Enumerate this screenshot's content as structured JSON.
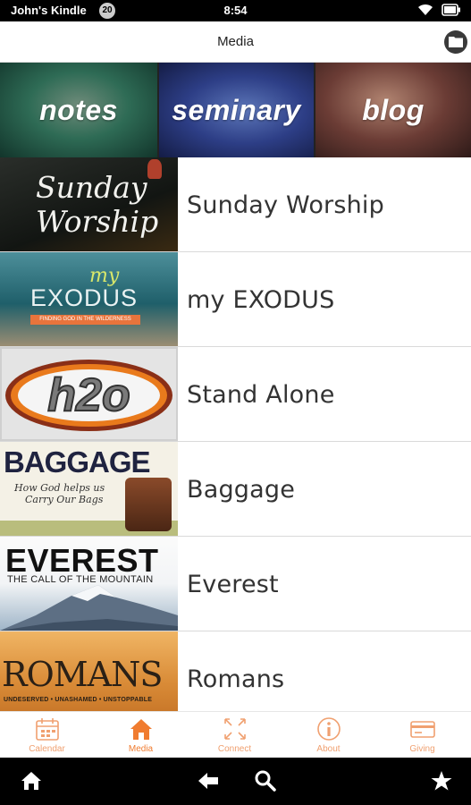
{
  "status_bar": {
    "owner": "John's Kindle",
    "notification_count": "20",
    "time": "8:54"
  },
  "header": {
    "title": "Media",
    "folder_icon": "folder-icon"
  },
  "categories": [
    {
      "label": "notes"
    },
    {
      "label": "seminary"
    },
    {
      "label": "blog"
    }
  ],
  "series": [
    {
      "title": "Sunday Worship",
      "thumb_line1": "Sunday",
      "thumb_line2": "Worship"
    },
    {
      "title": "my EXODUS",
      "thumb_my": "my",
      "thumb_main": "EXODUS",
      "thumb_sub": "FINDING GOD IN THE WILDERNESS"
    },
    {
      "title": "Stand Alone",
      "thumb_main": "h2o"
    },
    {
      "title": "Baggage",
      "thumb_main": "BAGGAGE",
      "thumb_sub1": "How God helps us",
      "thumb_sub2": "Carry Our Bags"
    },
    {
      "title": "Everest",
      "thumb_main": "EVEREST",
      "thumb_sub": "THE CALL OF THE MOUNTAIN"
    },
    {
      "title": "Romans",
      "thumb_main": "ROMANS",
      "thumb_sub": "UNDESERVED • UNASHAMED • UNSTOPPABLE"
    }
  ],
  "tabs": [
    {
      "label": "Calendar",
      "icon": "calendar-icon"
    },
    {
      "label": "Media",
      "icon": "home-icon"
    },
    {
      "label": "Connect",
      "icon": "connect-icon"
    },
    {
      "label": "About",
      "icon": "info-icon"
    },
    {
      "label": "Giving",
      "icon": "card-icon"
    }
  ],
  "colors": {
    "accent": "#f07c30",
    "tab_inactive": "#f0a070"
  }
}
